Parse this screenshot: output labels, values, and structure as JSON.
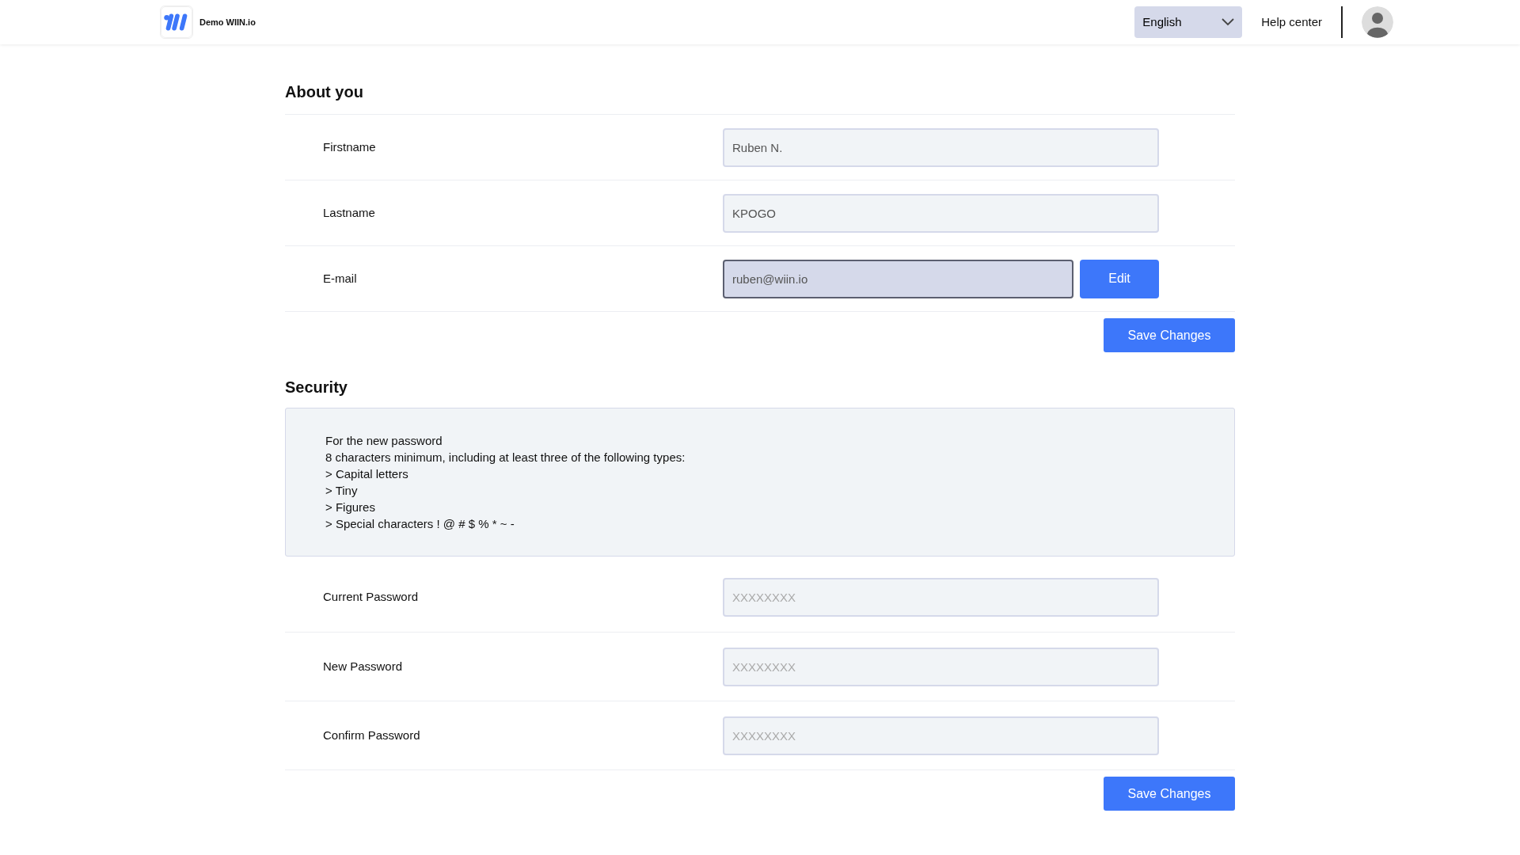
{
  "header": {
    "brand": "Demo WIIN.io",
    "language": "English",
    "help": "Help center"
  },
  "about": {
    "title": "About you",
    "fields": [
      {
        "label": "Firstname",
        "value": "Ruben N.",
        "disabled": false
      },
      {
        "label": "Lastname",
        "value": "KPOGO",
        "disabled": false
      },
      {
        "label": "E-mail",
        "value": "ruben@wiin.io",
        "disabled": true,
        "action": "Edit"
      }
    ],
    "save": "Save Changes"
  },
  "security": {
    "title": "Security",
    "notice": [
      "For the new password",
      "8 characters minimum, including at least three of the following types:",
      "> Capital letters",
      "> Tiny",
      "> Figures",
      "> Special characters ! @ # $ % * ~ -"
    ],
    "fields": [
      {
        "label": "Current Password",
        "placeholder": "XXXXXXXX",
        "disabled": false
      },
      {
        "label": "New Password",
        "placeholder": "XXXXXXXX",
        "disabled": false
      },
      {
        "label": "Confirm Password",
        "placeholder": "XXXXXXXX",
        "disabled": false
      }
    ],
    "save": "Save Changes"
  }
}
